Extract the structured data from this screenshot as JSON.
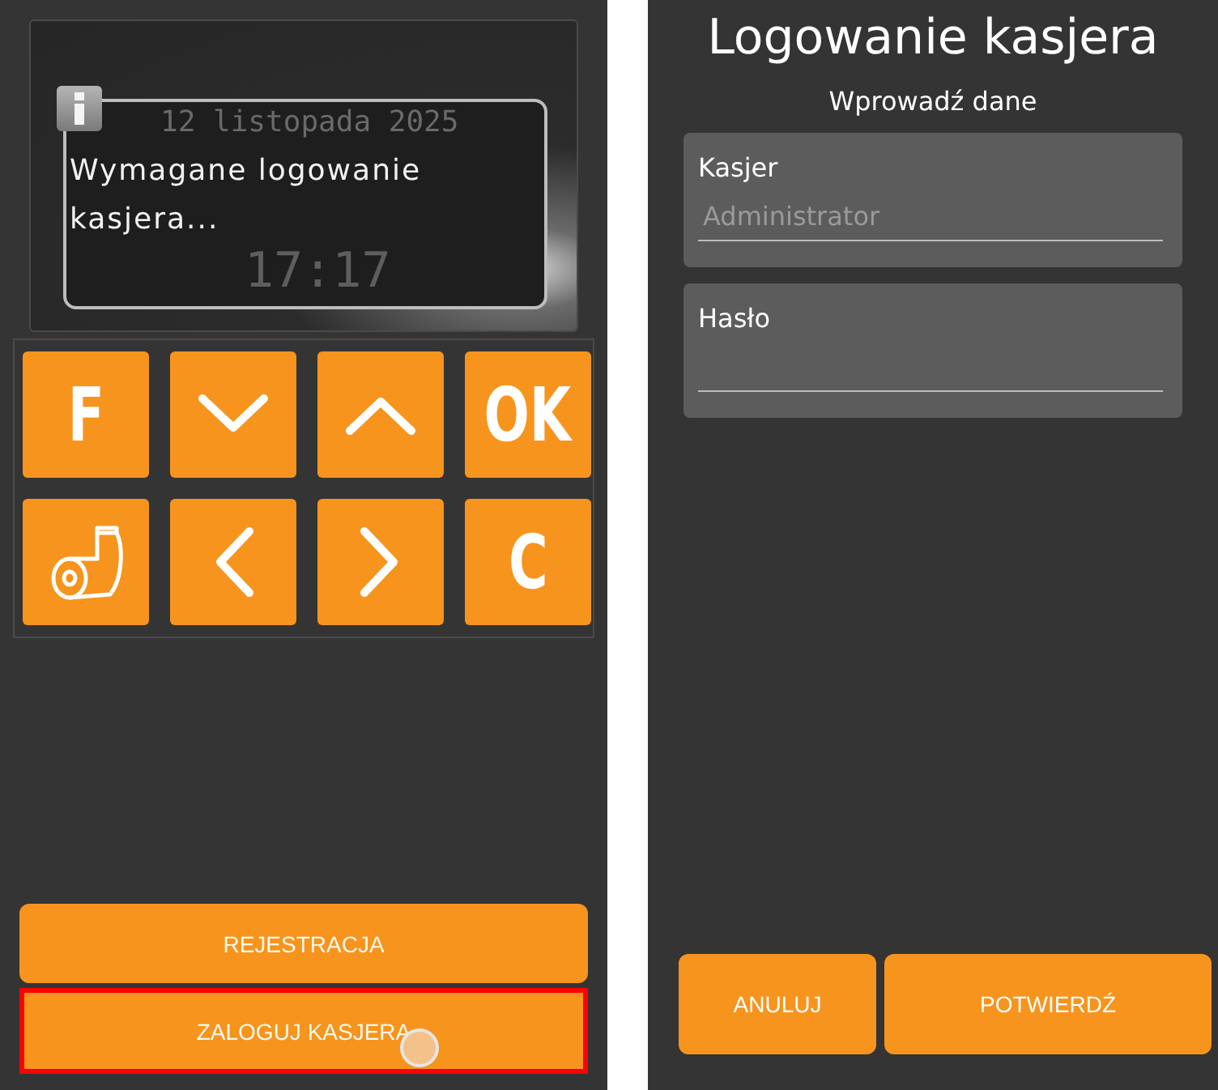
{
  "left_screen": {
    "display": {
      "date": "12 listopada 2025",
      "time": "17:17",
      "message": "Wymagane logowanie kasjera..."
    },
    "keypad": [
      {
        "kind": "label",
        "label": "F"
      },
      {
        "kind": "chevron-down"
      },
      {
        "kind": "chevron-up"
      },
      {
        "kind": "label",
        "label": "OK"
      },
      {
        "kind": "paper-roll"
      },
      {
        "kind": "chevron-left"
      },
      {
        "kind": "chevron-right"
      },
      {
        "kind": "label",
        "label": "C"
      }
    ],
    "buttons": [
      {
        "label": "REJESTRACJA",
        "highlighted": false,
        "touched": false
      },
      {
        "label": "ZALOGUJ KASJERA",
        "highlighted": true,
        "touched": true
      }
    ]
  },
  "right_screen": {
    "title": "Logowanie kasjera",
    "subtitle": "Wprowadź dane",
    "fields": [
      {
        "label": "Kasjer",
        "placeholder": "Administrator"
      },
      {
        "label": "Hasło"
      }
    ],
    "buttons": [
      {
        "label": "ANULUJ"
      },
      {
        "label": "POTWIERDŹ"
      }
    ]
  }
}
